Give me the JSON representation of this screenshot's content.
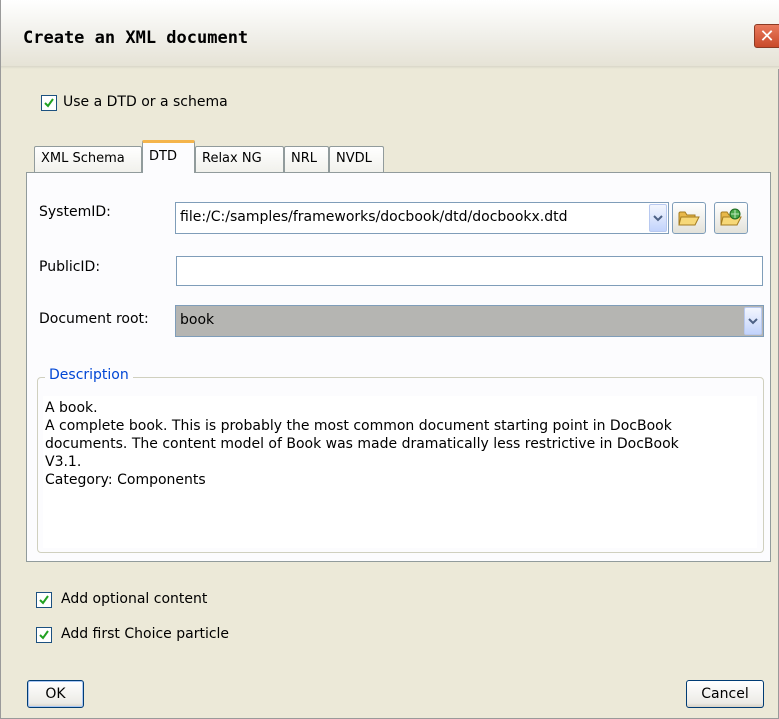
{
  "dialog": {
    "title": "Create an XML document",
    "close_glyph": "✕"
  },
  "use_schema": {
    "label": "Use a DTD or a schema",
    "checked": true
  },
  "tabs": [
    {
      "label": "XML Schema",
      "active": false
    },
    {
      "label": "DTD",
      "active": true
    },
    {
      "label": "Relax NG",
      "active": false
    },
    {
      "label": "NRL",
      "active": false
    },
    {
      "label": "NVDL",
      "active": false
    }
  ],
  "dtd": {
    "system_id_label": "SystemID:",
    "system_id_value": "file:/C:/samples/frameworks/docbook/dtd/docbookx.dtd",
    "public_id_label": "PublicID:",
    "public_id_value": "",
    "root_label": "Document root:",
    "root_value": "book",
    "browse_icon": "folder-open-icon",
    "browse_url_icon": "folder-url-icon"
  },
  "description": {
    "legend": "Description",
    "lines": [
      "A book.",
      "A complete book. This is probably the most common document starting point in DocBook",
      "documents. The content model of Book was made dramatically less restrictive in DocBook",
      "V3.1.",
      "Category: Components"
    ]
  },
  "options": {
    "optional_content": {
      "label": "Add optional content",
      "checked": true
    },
    "first_choice": {
      "label": "Add first Choice particle",
      "checked": true
    }
  },
  "buttons": {
    "ok": "OK",
    "cancel": "Cancel"
  },
  "colors": {
    "dialog_bg": "#ece9d8",
    "tab_accent": "#f4b44b",
    "legend_text": "#0046d5",
    "close_button": "#c94a2a"
  }
}
